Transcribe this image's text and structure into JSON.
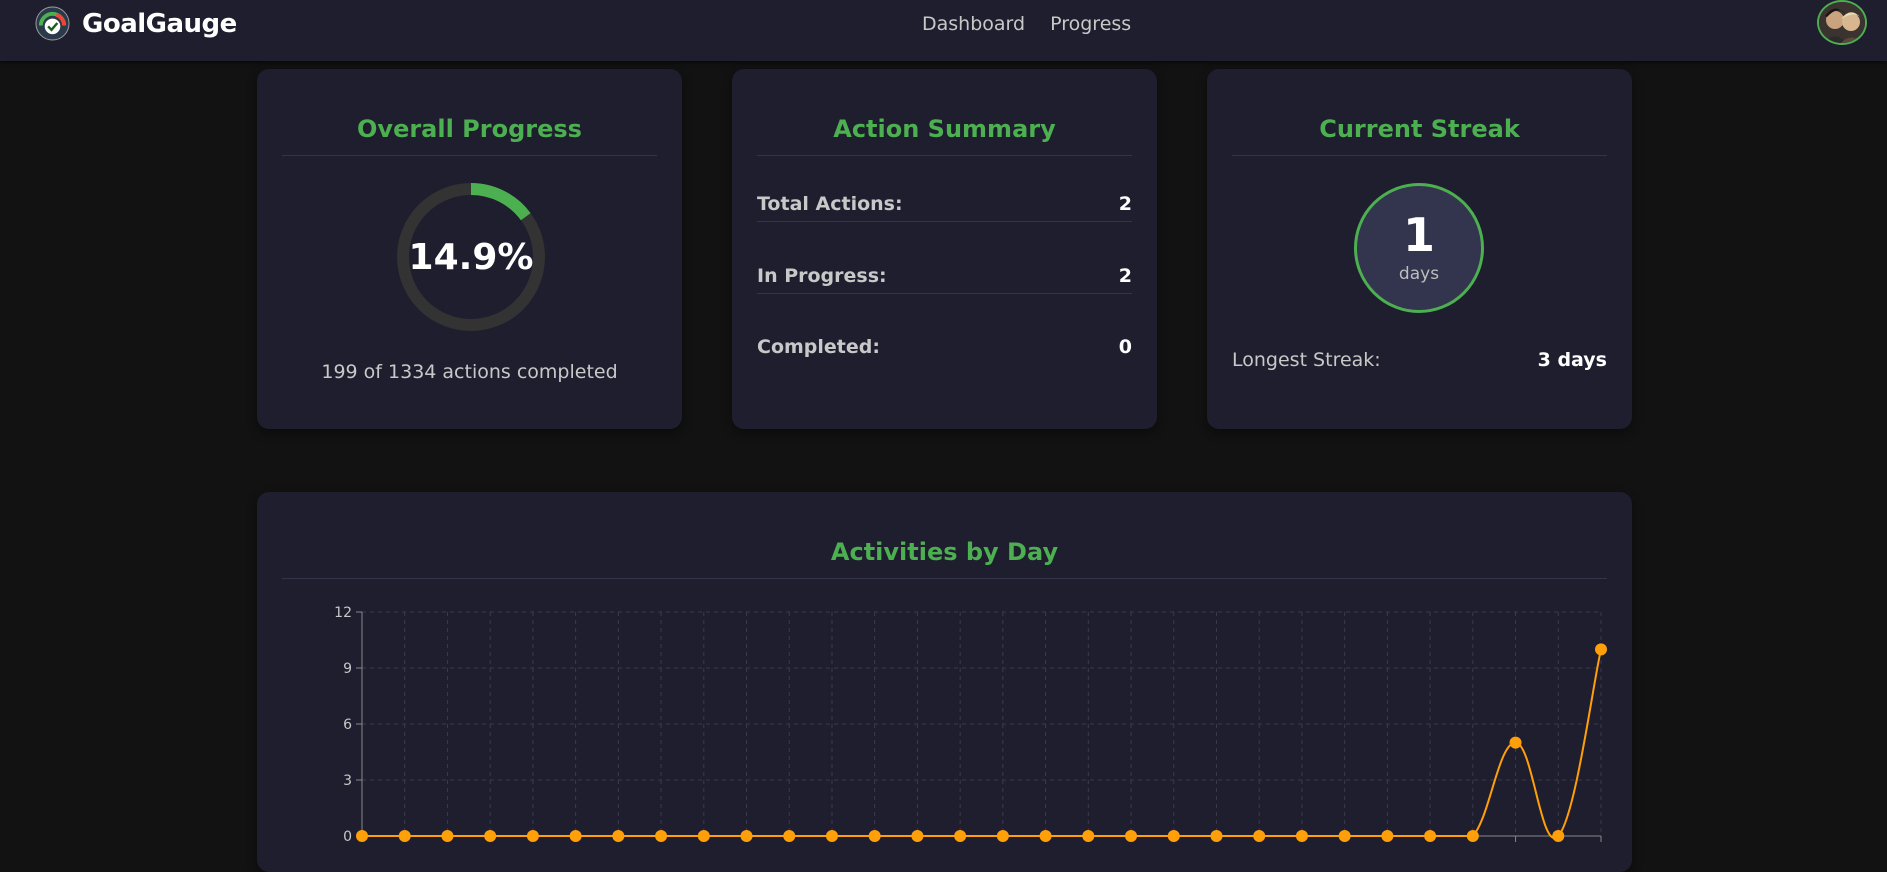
{
  "header": {
    "brand": "GoalGauge",
    "nav": [
      "Dashboard",
      "Progress"
    ]
  },
  "overall_progress": {
    "title": "Overall Progress",
    "percent_label": "14.9%",
    "percent": 14.9,
    "summary": "199 of 1334 actions completed"
  },
  "action_summary": {
    "title": "Action Summary",
    "rows": [
      {
        "label": "Total Actions:",
        "value": "2"
      },
      {
        "label": "In Progress:",
        "value": "2"
      },
      {
        "label": "Completed:",
        "value": "0"
      }
    ]
  },
  "current_streak": {
    "title": "Current Streak",
    "value": "1",
    "unit": "days",
    "longest_label": "Longest Streak:",
    "longest_value": "3 days"
  },
  "colors": {
    "accent": "#4caf50",
    "line": "#ff9f0a",
    "card": "#1e1e2e",
    "background": "#121212"
  },
  "activities": {
    "title": "Activities by Day"
  },
  "chart_data": {
    "type": "line",
    "title": "Activities by Day",
    "ylim": [
      0,
      12
    ],
    "yticks": [
      0,
      3,
      6,
      9,
      12
    ],
    "grid": true,
    "x": [
      1,
      2,
      3,
      4,
      5,
      6,
      7,
      8,
      9,
      10,
      11,
      12,
      13,
      14,
      15,
      16,
      17,
      18,
      19,
      20,
      21,
      22,
      23,
      24,
      25,
      26,
      27,
      28,
      29,
      30
    ],
    "series": [
      {
        "values": [
          0,
          0,
          0,
          0,
          0,
          0,
          0,
          0,
          0,
          0,
          0,
          0,
          0,
          0,
          0,
          0,
          0,
          0,
          0,
          0,
          0,
          0,
          0,
          0,
          0,
          0,
          0,
          5,
          0,
          10
        ]
      }
    ]
  }
}
